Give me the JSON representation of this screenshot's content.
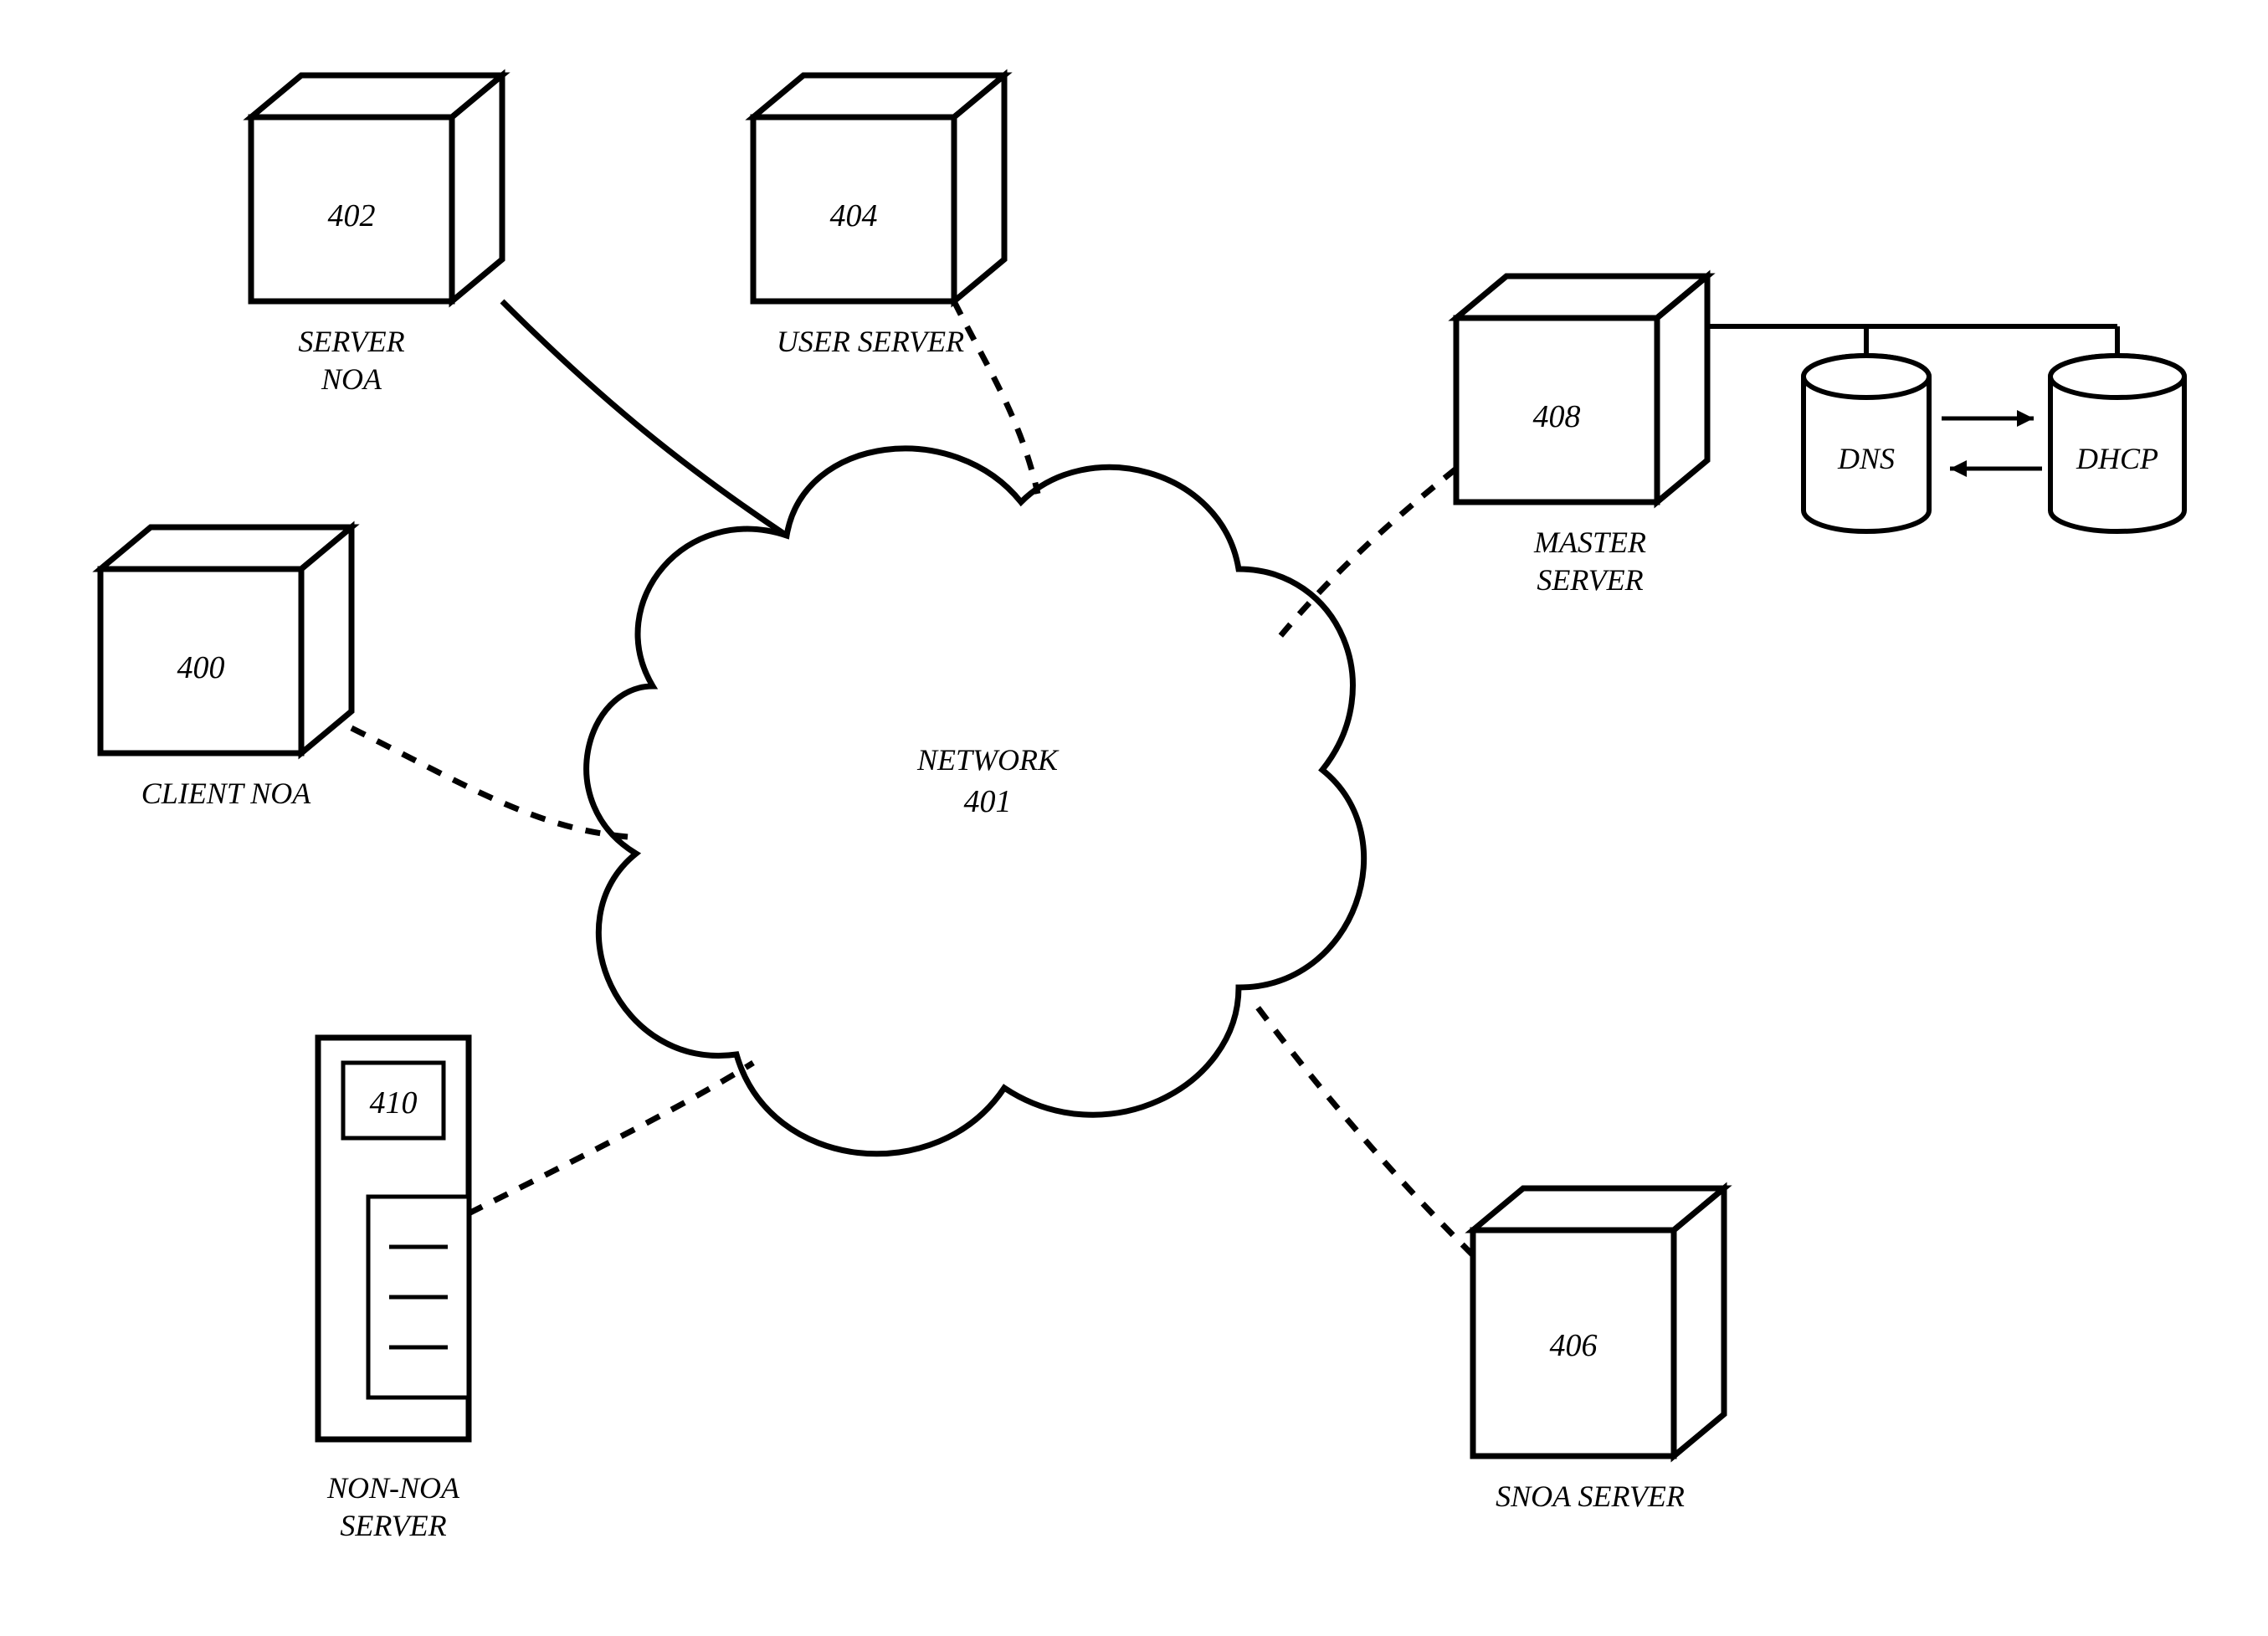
{
  "nodes": {
    "server_noa": {
      "num": "402",
      "label_1": "SERVER",
      "label_2": "NOA"
    },
    "user_server": {
      "num": "404",
      "label": "USER SERVER"
    },
    "client_noa": {
      "num": "400",
      "label": "CLIENT NOA"
    },
    "master_server": {
      "num": "408",
      "label_1": "MASTER",
      "label_2": "SERVER"
    },
    "snoa_server": {
      "num": "406",
      "label": "SNOA SERVER"
    },
    "non_noa_server": {
      "num": "410",
      "label_1": "NON-NOA",
      "label_2": "SERVER"
    },
    "network": {
      "label": "NETWORK",
      "num": "401"
    },
    "dns": {
      "label": "DNS"
    },
    "dhcp": {
      "label": "DHCP"
    }
  }
}
